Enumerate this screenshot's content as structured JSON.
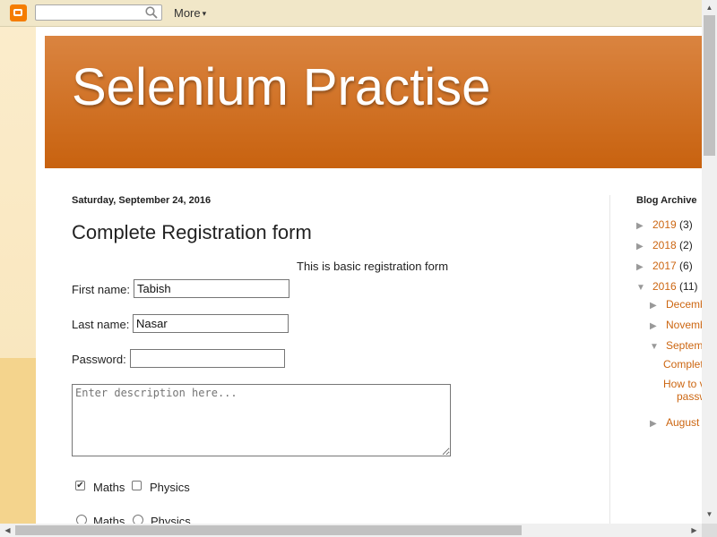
{
  "navbar": {
    "logo_icon": "blogger-icon",
    "search_value": "",
    "search_icon": "search-icon",
    "more_label": "More",
    "more_arrow": "▾"
  },
  "header": {
    "blog_title": "Selenium Practise",
    "accent_color": "#cc6611"
  },
  "post": {
    "date": "Saturday, September 24, 2016",
    "title": "Complete Registration form",
    "intro": "This is basic registration form",
    "form": {
      "first_name_label": "First name:",
      "first_name_value": "Tabish",
      "last_name_label": "Last name:",
      "last_name_value": "Nasar",
      "password_label": "Password:",
      "password_value": "",
      "description_placeholder": "Enter description here...",
      "checkbox_maths_label": "Maths",
      "checkbox_maths_checked": true,
      "checkbox_physics_label": "Physics",
      "checkbox_physics_checked": false,
      "radio_maths_label": "Maths",
      "radio_physics_label": "Physics"
    }
  },
  "sidebar": {
    "archive_title": "Blog Archive",
    "years": [
      {
        "label": "2019",
        "count": "(3)",
        "expanded": false
      },
      {
        "label": "2018",
        "count": "(2)",
        "expanded": false
      },
      {
        "label": "2017",
        "count": "(6)",
        "expanded": false
      },
      {
        "label": "2016",
        "count": "(11)",
        "expanded": true
      }
    ],
    "months": [
      {
        "label": "December",
        "expanded": false
      },
      {
        "label": "November",
        "expanded": false
      },
      {
        "label": "September",
        "expanded": true
      },
      {
        "label": "August",
        "expanded": false
      }
    ],
    "posts": [
      {
        "label": "Complete Registration form"
      },
      {
        "label": "How to verify password",
        "line1": "How to v",
        "line2": "passw"
      }
    ],
    "collapsed_arrow": "▶",
    "expanded_arrow": "▼"
  },
  "scrollbars": {
    "up_arrow": "▲",
    "down_arrow": "▼",
    "left_arrow": "◀",
    "right_arrow": "▶"
  }
}
